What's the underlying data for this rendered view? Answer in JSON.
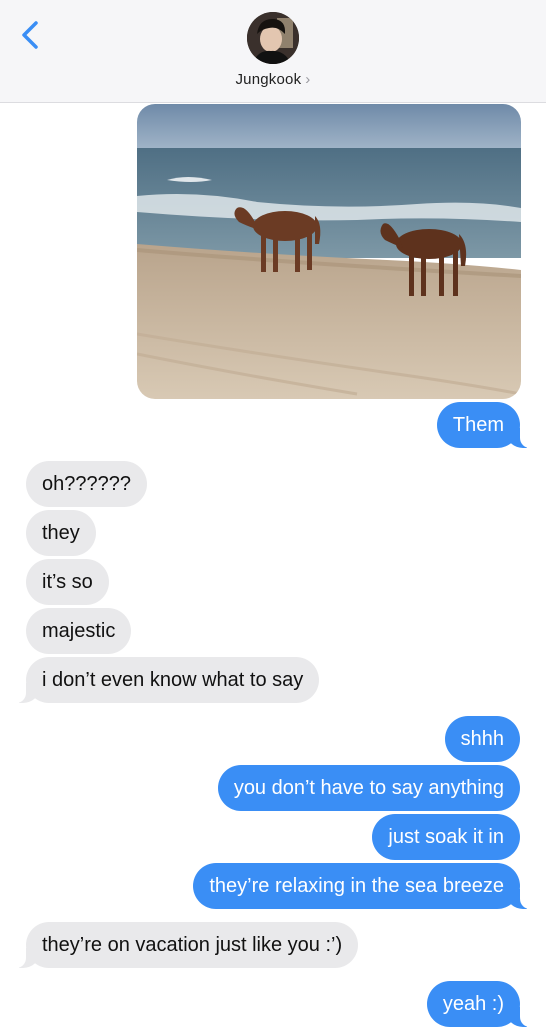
{
  "header": {
    "contact_name": "Jungkook",
    "chevron": "›"
  },
  "messages": [
    {
      "type": "image",
      "from": "me",
      "alt": "two horses on a beach"
    },
    {
      "from": "me",
      "text": "Them"
    },
    {
      "from": "them",
      "text": "oh??????"
    },
    {
      "from": "them",
      "text": "they"
    },
    {
      "from": "them",
      "text": "it’s so"
    },
    {
      "from": "them",
      "text": "majestic"
    },
    {
      "from": "them",
      "text": "i don’t even know what to say"
    },
    {
      "from": "me",
      "text": "shhh"
    },
    {
      "from": "me",
      "text": "you don’t have to say anything"
    },
    {
      "from": "me",
      "text": "just soak it in"
    },
    {
      "from": "me",
      "text": "they’re relaxing in the sea breeze"
    },
    {
      "from": "them",
      "text": "they’re on vacation just like you :’)"
    },
    {
      "from": "me",
      "text": "yeah :)"
    }
  ],
  "colors": {
    "accent": "#3a8ef5",
    "incoming_bubble": "#e9e9eb",
    "header_bg": "#f6f6f8"
  },
  "icons": {
    "back": "chevron-left-icon",
    "contact_more": "chevron-right-icon"
  }
}
